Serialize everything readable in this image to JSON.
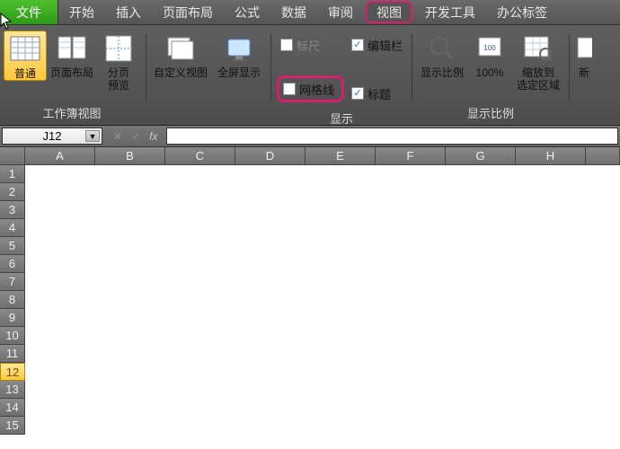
{
  "tabs": {
    "file": "文件",
    "items": [
      "开始",
      "插入",
      "页面布局",
      "公式",
      "数据",
      "审阅",
      "视图",
      "开发工具",
      "办公标签"
    ],
    "activeIndex": 6
  },
  "ribbon": {
    "group_workbook_views": {
      "label": "工作簿视图",
      "normal": "普通",
      "page_layout": "页面布局",
      "page_break_l1": "分页",
      "page_break_l2": "预览",
      "custom_views": "自定义视图",
      "full_screen": "全屏显示"
    },
    "group_show": {
      "label": "显示",
      "ruler": "标尺",
      "formula_bar": "编辑栏",
      "gridlines": "网格线",
      "headings": "标题",
      "ruler_checked": false,
      "formula_bar_checked": true,
      "gridlines_checked": false,
      "headings_checked": true
    },
    "group_zoom": {
      "label": "显示比例",
      "zoom": "显示比例",
      "hundred": "100%",
      "zoom_sel_l1": "缩放到",
      "zoom_sel_l2": "选定区域",
      "new_window_partial": "新"
    }
  },
  "formula_bar": {
    "namebox": "J12",
    "fx": "fx"
  },
  "sheet": {
    "columns": [
      "A",
      "B",
      "C",
      "D",
      "E",
      "F",
      "G",
      "H"
    ],
    "rows": [
      "1",
      "2",
      "3",
      "4",
      "5",
      "6",
      "7",
      "8",
      "9",
      "10",
      "11",
      "12",
      "13",
      "14",
      "15"
    ],
    "selected_row_index": 11
  }
}
